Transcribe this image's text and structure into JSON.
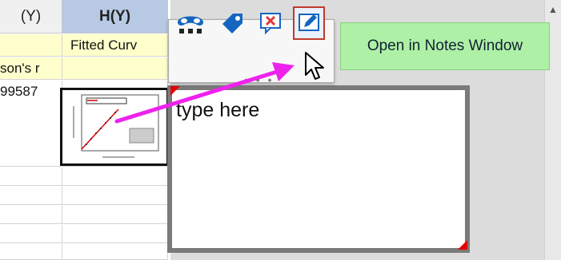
{
  "sheet": {
    "columns": [
      {
        "label": "(Y)"
      },
      {
        "label": "H(Y)"
      }
    ],
    "row_long_name": "Fitted Curv",
    "row_comment": "son's r",
    "row_value": "99587"
  },
  "toolbar": {
    "buttons": [
      {
        "name": "mask-icon"
      },
      {
        "name": "tag-icon"
      },
      {
        "name": "delete-note-icon"
      },
      {
        "name": "open-note-icon"
      }
    ]
  },
  "tooltip": {
    "text": "Open in Notes Window"
  },
  "note": {
    "text": "type here"
  },
  "colors": {
    "accent_arrow": "#ee22ee",
    "tooltip_bg": "#aef0a6",
    "note_border": "#7a7a7a",
    "flag_red": "#e60000"
  }
}
